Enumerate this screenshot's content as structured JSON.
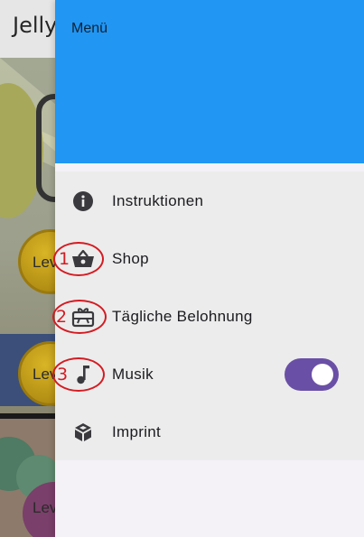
{
  "background_app": {
    "title": "Jelly",
    "level_labels": [
      "Lev",
      "Lev",
      "Lev"
    ]
  },
  "drawer": {
    "header_title": "Menü",
    "header_color": "#2196f3",
    "items": [
      {
        "label": "Instruktionen",
        "icon": "info-icon"
      },
      {
        "label": "Shop",
        "icon": "basket-icon"
      },
      {
        "label": "Tägliche Belohnung",
        "icon": "gift-card-icon"
      },
      {
        "label": "Musik",
        "icon": "music-note-icon",
        "toggle_on": true
      },
      {
        "label": "Imprint",
        "icon": "cube-icon"
      }
    ],
    "toggle_color": "#6a4fa6"
  },
  "annotations": [
    "1",
    "2",
    "3"
  ],
  "annotation_color": "#d41b22"
}
